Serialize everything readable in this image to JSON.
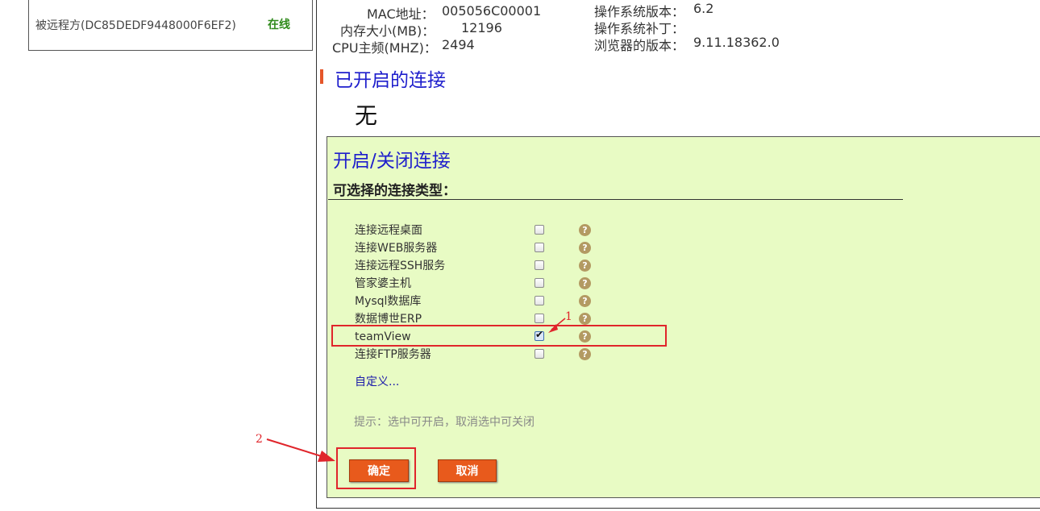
{
  "device": {
    "name": "被远程方(DC85DEDF9448000F6EF2)",
    "status": "在线"
  },
  "system_info": {
    "mac_label": "MAC地址：",
    "mac_value": "005056C00001",
    "memory_label": "内存大小(MB)：",
    "memory_value": "12196",
    "cpu_label": "CPU主频(MHZ)：",
    "cpu_value": "2494",
    "os_version_label": "操作系统版本：",
    "os_version_value": "6.2",
    "os_patch_label": "操作系统补丁：",
    "os_patch_value": "",
    "browser_label": "浏览器的版本：",
    "browser_value": "9.11.18362.0"
  },
  "open_connections": {
    "title": "已开启的连接",
    "value": "无"
  },
  "toggle_panel": {
    "title": "开启/关闭连接",
    "types_heading": "可选择的连接类型：",
    "connection_types": [
      {
        "label": "连接远程桌面",
        "checked": false
      },
      {
        "label": "连接WEB服务器",
        "checked": false
      },
      {
        "label": "连接远程SSH服务",
        "checked": false
      },
      {
        "label": "管家婆主机",
        "checked": false
      },
      {
        "label": "Mysql数据库",
        "checked": false
      },
      {
        "label": "数据博世ERP",
        "checked": false
      },
      {
        "label": "teamView",
        "checked": true
      },
      {
        "label": "连接FTP服务器",
        "checked": false
      }
    ],
    "help_glyph": "?",
    "custom_link": "自定义...",
    "hint": "提示：选中可开启，取消选中可关闭",
    "confirm_label": "确定",
    "cancel_label": "取消"
  },
  "annotations": {
    "marker_1": "1",
    "marker_2": "2",
    "color": "#e0252b"
  },
  "colors": {
    "title_blue": "#1e1ecc",
    "button_orange": "#e85a1c",
    "panel_green": "#e8fbc4",
    "online_green": "#2f8a1b"
  }
}
